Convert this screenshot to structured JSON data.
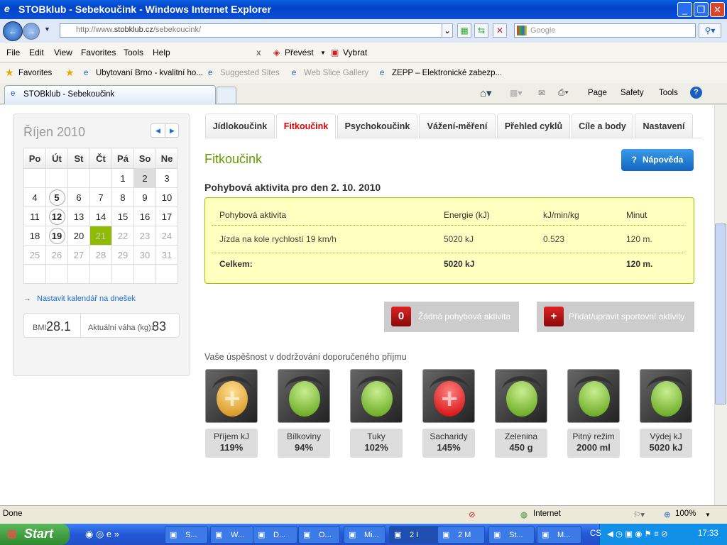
{
  "window": {
    "title": "STOBklub - Sebekoučink - Windows Internet Explorer",
    "min": "_",
    "max": "❐",
    "close": "✕"
  },
  "address": {
    "url_prefix": "http://www.",
    "url_host": "stobklub.cz",
    "url_path": "/sebekoucink/",
    "search_placeholder": "Google"
  },
  "menu": [
    "File",
    "Edit",
    "View",
    "Favorites",
    "Tools",
    "Help"
  ],
  "toolbar_extra": {
    "close": "x",
    "convert": "Převést",
    "select": "Vybrat"
  },
  "favorites": {
    "label": "Favorites",
    "items": [
      "Ubytovaní Brno - kvalitní ho...",
      "Suggested Sites",
      "Web Slice Gallery",
      "ZEPP – Elektronické zabezp..."
    ]
  },
  "ie_tab": {
    "title": "STOBklub - Sebekoučink"
  },
  "command_bar": {
    "page": "Page",
    "safety": "Safety",
    "tools": "Tools"
  },
  "calendar": {
    "month": "Říjen 2010",
    "weekdays": [
      "Po",
      "Út",
      "St",
      "Čt",
      "Pá",
      "So",
      "Ne"
    ],
    "weeks": [
      [
        "",
        "",
        "",
        "",
        "1",
        "2",
        "3"
      ],
      [
        "4",
        "5",
        "6",
        "7",
        "8",
        "9",
        "10"
      ],
      [
        "11",
        "12",
        "13",
        "14",
        "15",
        "16",
        "17"
      ],
      [
        "18",
        "19",
        "20",
        "21",
        "22",
        "23",
        "24"
      ],
      [
        "25",
        "26",
        "27",
        "28",
        "29",
        "30",
        "31"
      ],
      [
        "",
        "",
        "",
        "",
        "",
        "",
        ""
      ]
    ],
    "selected_day": "2",
    "today": "21",
    "marked_days": [
      "5",
      "12",
      "19"
    ],
    "today_link": "Nastavit kalendář na dnešek"
  },
  "bmi": {
    "label": "BMI:",
    "value": "28.1",
    "weight_label": "Aktuální váha (kg):",
    "weight": "83"
  },
  "tabs": [
    {
      "label": "Jídlokoučink"
    },
    {
      "label": "Fitkoučink",
      "active": true
    },
    {
      "label": "Psychokoučink"
    },
    {
      "label": "Vážení-měření"
    },
    {
      "label": "Přehled cyklů"
    },
    {
      "label": "Cíle a body"
    },
    {
      "label": "Nastavení"
    }
  ],
  "main": {
    "title": "Fitkoučink",
    "help_button": "Nápověda",
    "help_icon": "?",
    "subheading": "Pohybová aktivita pro den 2. 10. 2010",
    "table": {
      "headers": [
        "Pohybová aktivita",
        "Energie (kJ)",
        "kJ/min/kg",
        "Minut"
      ],
      "rows": [
        [
          "Jízda na kole rychlostí 19 km/h",
          "5020 kJ",
          "0.523",
          "120 m."
        ]
      ],
      "total": [
        "Celkem:",
        "5020 kJ",
        "",
        "120 m."
      ]
    },
    "no_activity_button": "Žádná pohybová aktivita",
    "no_activity_icon": "0",
    "add_activity_button": "Přidat/upravit sportovní aktivity",
    "add_activity_icon": "+",
    "success_heading": "Vaše úspěšnost v dodržování doporučeného příjmu",
    "indicators": [
      {
        "label": "Příjem kJ",
        "value": "119%",
        "status": "orange",
        "symbol": "+"
      },
      {
        "label": "Bílkoviny",
        "value": "94%",
        "status": "green",
        "symbol": ""
      },
      {
        "label": "Tuky",
        "value": "102%",
        "status": "green",
        "symbol": ""
      },
      {
        "label": "Sacharidy",
        "value": "145%",
        "status": "red",
        "symbol": "+"
      },
      {
        "label": "Zelenina",
        "value": "450 g",
        "status": "green",
        "symbol": ""
      },
      {
        "label": "Pitný režim",
        "value": "2000 ml",
        "status": "green",
        "symbol": ""
      },
      {
        "label": "Výdej kJ",
        "value": "5020 kJ",
        "status": "green",
        "symbol": ""
      }
    ]
  },
  "status": {
    "text": "Done",
    "zone": "Internet",
    "zoom": "100%"
  },
  "taskbar": {
    "start": "Start",
    "tasks": [
      "S...",
      "W...",
      "D...",
      "O...",
      "Mi...",
      "2 I",
      "2 M",
      "St...",
      "M..."
    ],
    "lang": "CS",
    "clock": "17:33"
  },
  "colors": {
    "accent_green": "#8fbb00",
    "tab_active": "#dd0000",
    "help_blue": "#1a78d8"
  }
}
